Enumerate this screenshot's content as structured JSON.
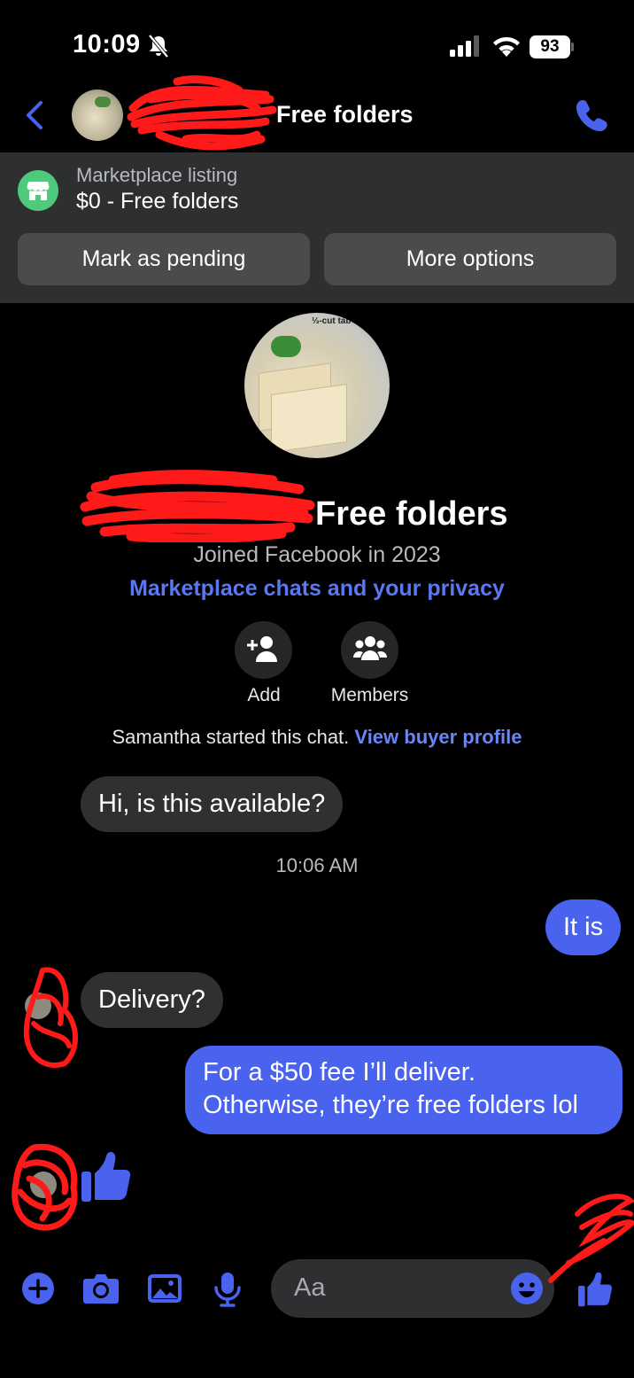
{
  "status_bar": {
    "time": "10:09",
    "battery": "93"
  },
  "header": {
    "title": "Free folders"
  },
  "banner": {
    "label": "Marketplace listing",
    "listing": "$0 - Free folders",
    "mark_pending": "Mark as pending",
    "more_options": "More options"
  },
  "profile": {
    "name": "Free folders",
    "joined": "Joined Facebook in 2023",
    "privacy_link": "Marketplace chats and your privacy",
    "add_label": "Add",
    "members_label": "Members"
  },
  "chat_start": {
    "text": "Samantha started this chat.",
    "link": "View buyer profile"
  },
  "messages": [
    {
      "from": "buyer",
      "text": "Hi, is this available?"
    },
    {
      "from": "timestamp",
      "text": "10:06 AM"
    },
    {
      "from": "me",
      "text": "It is"
    },
    {
      "from": "buyer",
      "text": "Delivery?"
    },
    {
      "from": "me",
      "text_line1": "For a $50 fee I’ll deliver.",
      "text_line2": "Otherwise, they’re free folders lol"
    },
    {
      "from": "buyer",
      "text": "",
      "icon": "thumbs-up-icon"
    }
  ],
  "composer": {
    "placeholder": "Aa"
  },
  "colors": {
    "accent": "#4a63ee",
    "link": "#5a78f0",
    "banner_bg": "#2e2f31",
    "shop_green": "#4fc97b",
    "bubble_in": "#303033"
  },
  "icons": [
    "back-icon",
    "phone-icon",
    "shop-icon",
    "add-person-icon",
    "members-icon",
    "thumbs-up-icon",
    "plus-icon",
    "camera-icon",
    "gallery-icon",
    "microphone-icon",
    "emoji-icon"
  ]
}
